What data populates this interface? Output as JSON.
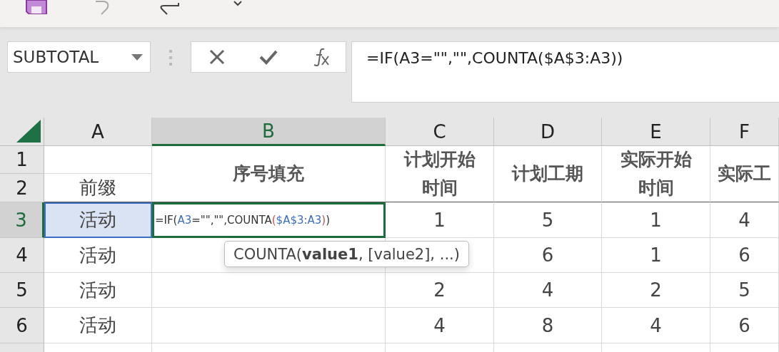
{
  "name_box": {
    "value": "SUBTOTAL"
  },
  "formula_bar": {
    "value": "=IF(A3=\"\",\"\",COUNTA($A$3:A3))"
  },
  "columns": [
    {
      "label": "A",
      "selected": false
    },
    {
      "label": "B",
      "selected": true
    },
    {
      "label": "C",
      "selected": false
    },
    {
      "label": "D",
      "selected": false
    },
    {
      "label": "E",
      "selected": false
    },
    {
      "label": "F",
      "selected": false
    }
  ],
  "row_headers": [
    {
      "label": "1",
      "selected": false
    },
    {
      "label": "2",
      "selected": false
    },
    {
      "label": "3",
      "selected": true
    },
    {
      "label": "4",
      "selected": false
    },
    {
      "label": "5",
      "selected": false
    },
    {
      "label": "6",
      "selected": false
    }
  ],
  "header_cells": {
    "a2": "前缀",
    "merged": [
      {
        "lines": [
          "序号填充"
        ]
      },
      {
        "lines": [
          "计划开始",
          "时间"
        ]
      },
      {
        "lines": [
          "计划工期"
        ]
      },
      {
        "lines": [
          "实际开始",
          "时间"
        ]
      },
      {
        "lines": [
          "实际工"
        ]
      }
    ]
  },
  "rows": [
    {
      "a": "活动",
      "a_referenced": true,
      "formula": [
        {
          "text": "=IF(",
          "color": "#333333"
        },
        {
          "text": "A3",
          "color": "#3c6ec2"
        },
        {
          "text": "=\"\",\"\",COUNTA",
          "color": "#333333"
        },
        {
          "text": "(",
          "color": "#c0504d"
        },
        {
          "text": "$A$3:A3",
          "color": "#3c6ec2"
        },
        {
          "text": ")",
          "color": "#c0504d"
        },
        {
          "text": ")",
          "color": "#333333"
        }
      ],
      "c": "1",
      "d": "5",
      "e": "1",
      "f": "4"
    },
    {
      "a": "活动",
      "a_referenced": false,
      "d": "6",
      "e": "1",
      "f": "6"
    },
    {
      "a": "活动",
      "a_referenced": false,
      "c": "2",
      "d": "4",
      "e": "2",
      "f": "5"
    },
    {
      "a": "活动",
      "a_referenced": false,
      "c": "4",
      "d": "8",
      "e": "4",
      "f": "6"
    }
  ],
  "tooltip": {
    "text": "COUNTA(**value1**, [value2], ...)"
  }
}
